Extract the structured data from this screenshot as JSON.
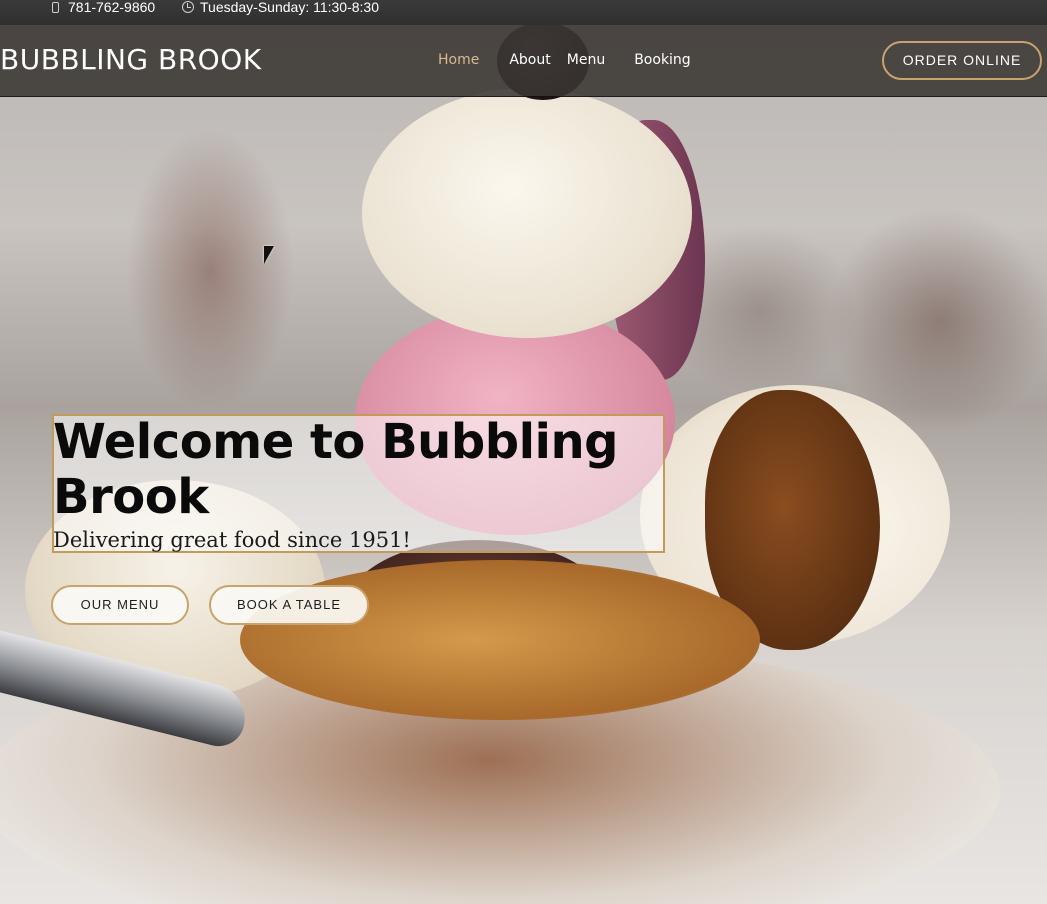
{
  "topbar": {
    "phone_icon": "phone-icon",
    "phone": "781-762-9860",
    "clock_icon": "clock-icon",
    "hours": "Tuesday-Sunday: 11:30-8:30"
  },
  "nav": {
    "brand": "BUBBLING BROOK",
    "links": [
      {
        "label": "Home",
        "active": true
      },
      {
        "label": "About",
        "active": false
      },
      {
        "label": "Menu",
        "active": false
      },
      {
        "label": "Booking",
        "active": false
      }
    ],
    "order_button": "ORDER ONLINE"
  },
  "hero": {
    "title": "Welcome to Bubbling Brook",
    "subtitle": "Delivering great food since 1951!",
    "buttons": {
      "menu": "OUR MENU",
      "book": "BOOK A TABLE"
    }
  },
  "colors": {
    "accent_gold": "#c8a46c",
    "active_link": "#d9b98d",
    "nav_background": "#3a3632"
  }
}
